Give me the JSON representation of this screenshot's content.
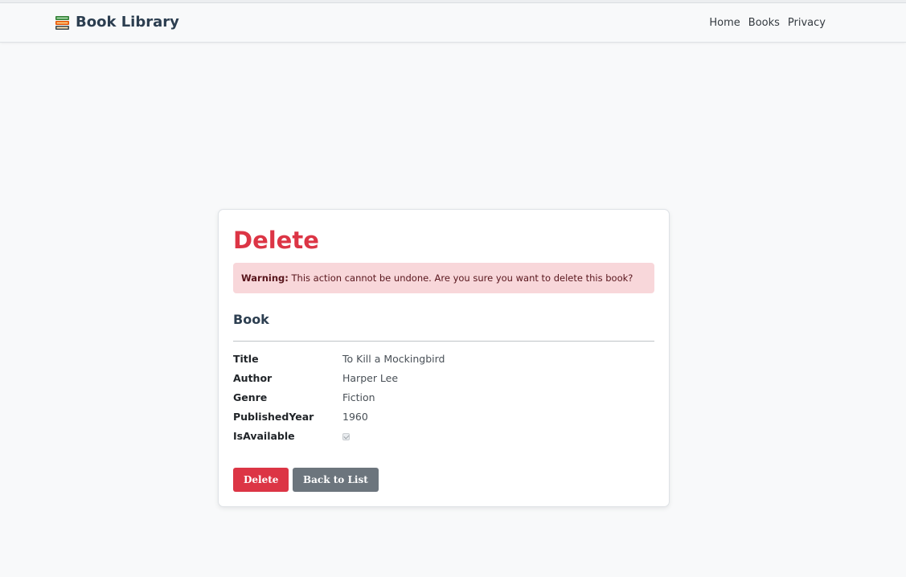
{
  "navbar": {
    "brand": "Book Library",
    "brand_icon": "books-icon",
    "links": [
      "Home",
      "Books",
      "Privacy"
    ]
  },
  "page": {
    "title": "Delete",
    "alert": {
      "strong": "Warning:",
      "text": " This action cannot be undone. Are you sure you want to delete this book?"
    },
    "section_title": "Book",
    "fields": [
      {
        "label": "Title",
        "value": "To Kill a Mockingbird"
      },
      {
        "label": "Author",
        "value": "Harper Lee"
      },
      {
        "label": "Genre",
        "value": "Fiction"
      },
      {
        "label": "PublishedYear",
        "value": "1960"
      },
      {
        "label": "IsAvailable",
        "checked": true
      }
    ],
    "buttons": {
      "delete": "Delete",
      "back": "Back to List"
    }
  },
  "colors": {
    "danger": "#dc3545",
    "secondary": "#6c757d",
    "alert_bg": "#f8d7da",
    "heading": "#2c3e50"
  }
}
